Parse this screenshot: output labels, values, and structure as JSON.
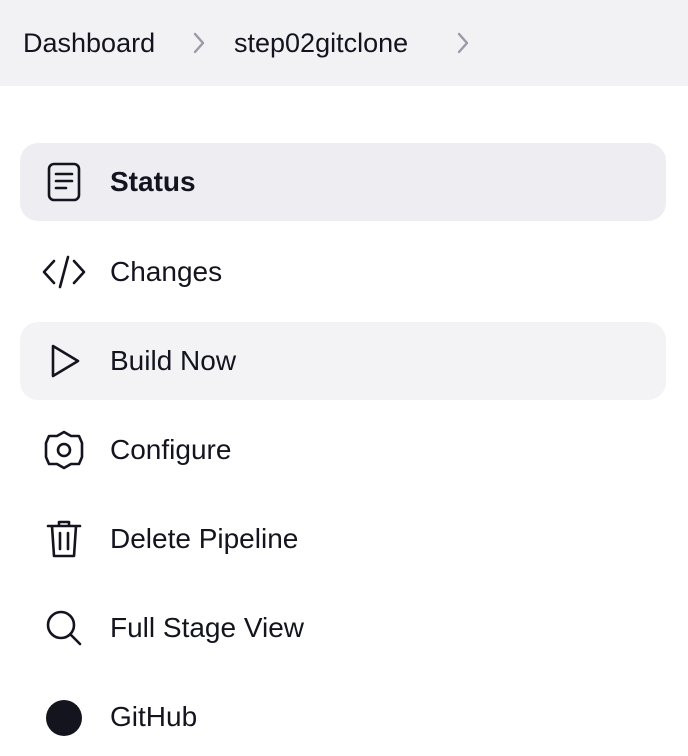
{
  "breadcrumb": {
    "items": [
      {
        "label": "Dashboard"
      },
      {
        "label": "step02gitclone"
      }
    ]
  },
  "sidebar": {
    "items": [
      {
        "label": "Status",
        "icon": "document-icon",
        "state": "active"
      },
      {
        "label": "Changes",
        "icon": "code-icon",
        "state": "default"
      },
      {
        "label": "Build Now",
        "icon": "play-icon",
        "state": "hover"
      },
      {
        "label": "Configure",
        "icon": "gear-icon",
        "state": "default"
      },
      {
        "label": "Delete Pipeline",
        "icon": "trash-icon",
        "state": "default"
      },
      {
        "label": "Full Stage View",
        "icon": "search-icon",
        "state": "default"
      },
      {
        "label": "GitHub",
        "icon": "github-icon",
        "state": "default"
      }
    ]
  },
  "colors": {
    "breadcrumb_bg": "#f2f2f5",
    "active_item_bg": "#ededf2",
    "hover_item_bg": "#f3f3f6",
    "text": "#14141f",
    "separator": "#9a9aa6"
  }
}
